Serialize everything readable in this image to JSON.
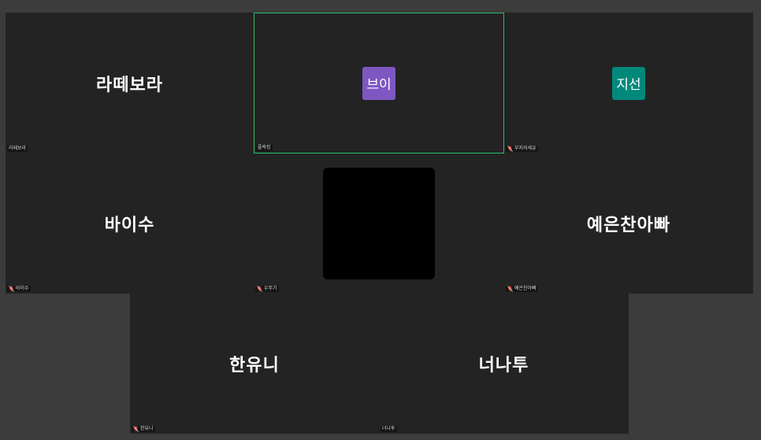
{
  "colors": {
    "background": "#3c3c3c",
    "tile": "#232323",
    "active_border": "#23c26a",
    "muted_icon": "#e0443e"
  },
  "tiles": [
    {
      "display_name": "라떼보라",
      "tag": "라떼보라",
      "muted": false,
      "active": false
    },
    {
      "avatar_text": "브이",
      "avatar_color": "#7e57c2",
      "tag": "플락킹",
      "muted": false,
      "active": true
    },
    {
      "avatar_text": "지선",
      "avatar_color": "#00897b",
      "tag": "부지의세유",
      "muted": true,
      "active": false
    },
    {
      "display_name": "바이수",
      "tag": "바이수",
      "muted": true,
      "active": false
    },
    {
      "video": true,
      "tag": "우주기",
      "muted": true,
      "active": false
    },
    {
      "display_name": "예은찬아빠",
      "tag": "예은찬아빠",
      "muted": true,
      "active": false
    },
    {
      "display_name": "한유니",
      "tag": "한유니",
      "muted": true,
      "active": false
    },
    {
      "display_name": "너나투",
      "tag": "너나투",
      "muted": false,
      "active": false
    }
  ]
}
